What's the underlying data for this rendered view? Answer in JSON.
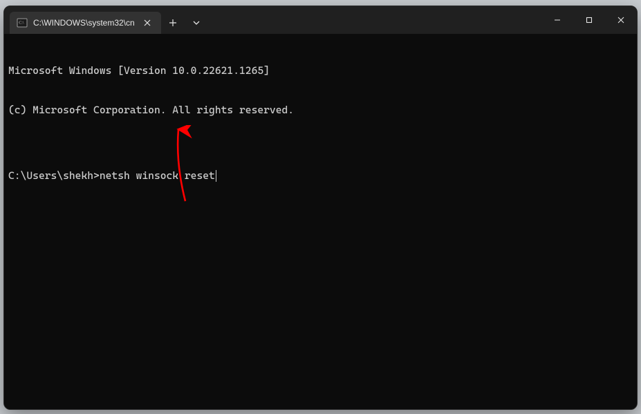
{
  "titlebar": {
    "tab_title": "C:\\WINDOWS\\system32\\cn",
    "tab_icon_name": "cmd-icon"
  },
  "win_controls": {
    "minimize": "Minimize",
    "maximize": "Maximize",
    "close": "Close"
  },
  "terminal": {
    "line1": "Microsoft Windows [Version 10.0.22621.1265]",
    "line2": "(c) Microsoft Corporation. All rights reserved.",
    "blank": "",
    "prompt": "C:\\Users\\shekh>",
    "command": "netsh winsock reset"
  },
  "colors": {
    "bg": "#0c0c0c",
    "titlebar": "#202020",
    "tab": "#323232",
    "text": "#cccccc",
    "arrow": "#ff0000"
  }
}
